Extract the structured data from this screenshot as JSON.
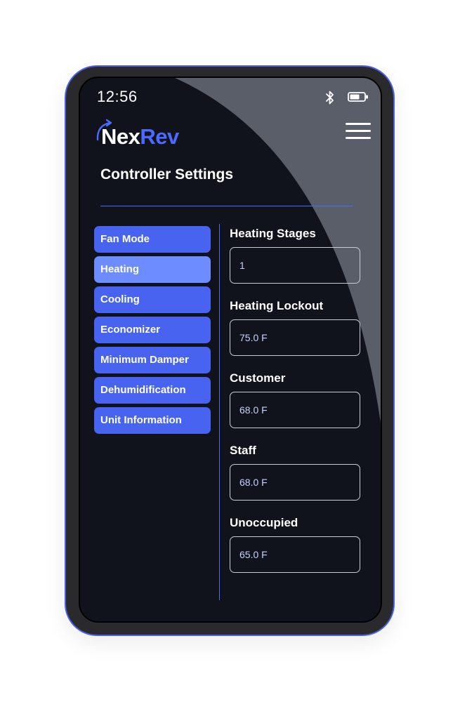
{
  "status_bar": {
    "time": "12:56",
    "icons": [
      "bluetooth-icon",
      "battery-icon"
    ]
  },
  "brand": {
    "name_part1": "Nex",
    "name_part2": "Rev",
    "accent_color": "#4b6bff"
  },
  "page": {
    "title": "Controller Settings"
  },
  "sidebar": {
    "items": [
      {
        "label": "Fan Mode",
        "active": false
      },
      {
        "label": "Heating",
        "active": true
      },
      {
        "label": "Cooling",
        "active": false
      },
      {
        "label": "Economizer",
        "active": false
      },
      {
        "label": "Minimum Damper",
        "active": false
      },
      {
        "label": "Dehumidification",
        "active": false
      },
      {
        "label": "Unit Information",
        "active": false
      }
    ]
  },
  "fields": [
    {
      "label": "Heating Stages",
      "value": "1"
    },
    {
      "label": "Heating Lockout",
      "value": "75.0 F"
    },
    {
      "label": "Customer",
      "value": "68.0 F"
    },
    {
      "label": "Staff",
      "value": "68.0 F"
    },
    {
      "label": "Unoccupied",
      "value": "65.0 F"
    }
  ],
  "colors": {
    "screen_bg": "#10131c",
    "button": "#4763ef",
    "button_active": "#6c8cff",
    "device_border": "#4b5fe6"
  }
}
